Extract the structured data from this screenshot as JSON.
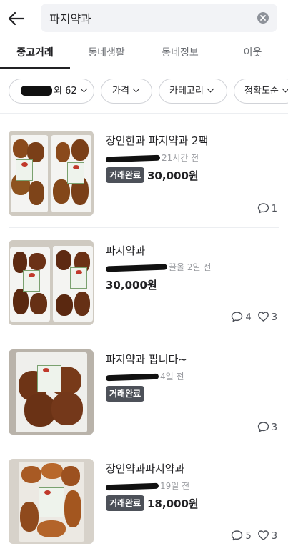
{
  "search": {
    "query": "파지약과"
  },
  "tabs": [
    {
      "label": "중고거래",
      "active": true
    },
    {
      "label": "동네생활",
      "active": false
    },
    {
      "label": "동네정보",
      "active": false
    },
    {
      "label": "이웃",
      "active": false
    }
  ],
  "filters": {
    "location_suffix": "외 62",
    "price": "가격",
    "category": "카테고리",
    "sort": "정확도순"
  },
  "listings": [
    {
      "title": "장인한과 파지약과 2팩",
      "time": "21시간 전",
      "status": "거래완료",
      "price": "30,000원",
      "chat_count": "1",
      "like_count": ""
    },
    {
      "title": "파지약과",
      "time": "끌올 2일 전",
      "status": "",
      "price": "30,000원",
      "chat_count": "4",
      "like_count": "3"
    },
    {
      "title": "파지약과 팝니다~",
      "time": "4일 전",
      "status": "거래완료",
      "price": "",
      "chat_count": "3",
      "like_count": ""
    },
    {
      "title": "장인약과파지약과",
      "time": "19일 전",
      "status": "거래완료",
      "price": "18,000원",
      "chat_count": "5",
      "like_count": "3"
    }
  ],
  "icons": {
    "back": "arrow-left-icon",
    "clear": "clear-circle-icon",
    "chat": "chat-bubble-icon",
    "like": "heart-icon"
  },
  "colors": {
    "text": "#212124",
    "muted": "#9a9ca1",
    "badge": "#4d5159"
  }
}
